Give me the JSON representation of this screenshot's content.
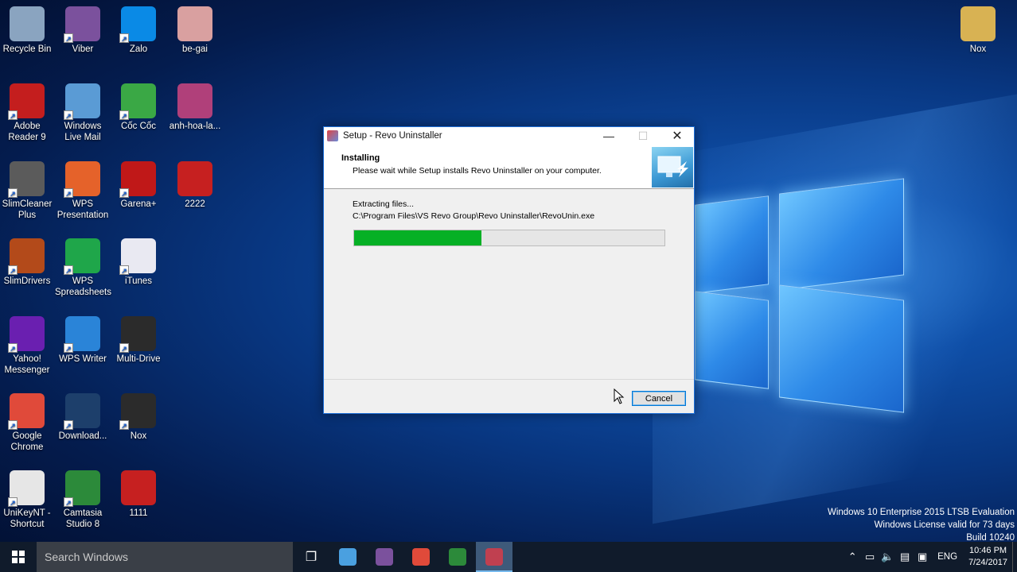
{
  "desktop": {
    "icons": [
      {
        "label": "Recycle Bin",
        "icon": "recycle-bin-icon",
        "color": "#8aa4c0"
      },
      {
        "label": "Viber",
        "icon": "viber-icon",
        "color": "#7b519d"
      },
      {
        "label": "Zalo",
        "icon": "zalo-icon",
        "color": "#0a8ae6"
      },
      {
        "label": "be-gai",
        "icon": "photo-icon",
        "color": "#d9a0a0"
      },
      {
        "label": "Adobe Reader 9",
        "icon": "adobe-reader-icon",
        "color": "#c41e1e"
      },
      {
        "label": "Windows Live Mail",
        "icon": "live-mail-icon",
        "color": "#5a9bd5"
      },
      {
        "label": "Cốc Cốc",
        "icon": "coccoc-icon",
        "color": "#3aa845"
      },
      {
        "label": "anh-hoa-la...",
        "icon": "photo-icon",
        "color": "#b0407a"
      },
      {
        "label": "SlimCleaner Plus",
        "icon": "slimcleaner-icon",
        "color": "#5b5b5b"
      },
      {
        "label": "WPS Presentation",
        "icon": "wps-presentation-icon",
        "color": "#e5622a"
      },
      {
        "label": "Garena+",
        "icon": "garena-icon",
        "color": "#c01818"
      },
      {
        "label": "2222",
        "icon": "video-icon",
        "color": "#c62020"
      },
      {
        "label": "SlimDrivers",
        "icon": "slimdrivers-icon",
        "color": "#b34a1a"
      },
      {
        "label": "WPS Spreadsheets",
        "icon": "wps-spreadsheets-icon",
        "color": "#1fa64a"
      },
      {
        "label": "iTunes",
        "icon": "itunes-icon",
        "color": "#e9e9f2"
      },
      {
        "label": "Yahoo! Messenger",
        "icon": "yahoo-messenger-icon",
        "color": "#6a1fb0"
      },
      {
        "label": "WPS Writer",
        "icon": "wps-writer-icon",
        "color": "#2a84d8"
      },
      {
        "label": "Multi-Drive",
        "icon": "nox-icon",
        "color": "#2b2b2b"
      },
      {
        "label": "Google Chrome",
        "icon": "chrome-icon",
        "color": "#e04a3a"
      },
      {
        "label": "Download...",
        "icon": "download-icon",
        "color": "#1d3f6b"
      },
      {
        "label": "Nox",
        "icon": "nox-icon",
        "color": "#2b2b2b"
      },
      {
        "label": "UniKeyNT - Shortcut",
        "icon": "unikey-icon",
        "color": "#e6e6e6"
      },
      {
        "label": "Camtasia Studio 8",
        "icon": "camtasia-icon",
        "color": "#2c8a3a"
      },
      {
        "label": "1111",
        "icon": "video-icon",
        "color": "#c62020"
      },
      {
        "label": "Nox",
        "icon": "folder-icon",
        "color": "#d8b253"
      }
    ]
  },
  "dialog": {
    "title": "Setup - Revo Uninstaller",
    "heading": "Installing",
    "subheading": "Please wait while Setup installs Revo Uninstaller on your computer.",
    "status": "Extracting files...",
    "file_path": "C:\\Program Files\\VS Revo Group\\Revo Uninstaller\\RevoUnin.exe",
    "progress": 0.41,
    "cancel_label": "Cancel",
    "minimize_glyph": "—",
    "maximize_glyph": "☐",
    "close_glyph": "✕",
    "accent": "#06b025"
  },
  "watermark": {
    "line1": "Windows 10 Enterprise 2015 LTSB Evaluation",
    "line2": "Windows License valid for 73 days",
    "line3": "Build 10240"
  },
  "taskbar": {
    "search_placeholder": "Search Windows",
    "apps": [
      {
        "icon": "task-view-icon",
        "glyph": "❐",
        "color": "#ffffff"
      },
      {
        "icon": "file-explorer-icon",
        "glyph": "",
        "color": "#4aa0e0"
      },
      {
        "icon": "viber-icon",
        "glyph": "",
        "color": "#7b519d"
      },
      {
        "icon": "chrome-icon",
        "glyph": "",
        "color": "#e04a3a"
      },
      {
        "icon": "camtasia-icon",
        "glyph": "",
        "color": "#2c8a3a"
      },
      {
        "icon": "revo-setup-icon",
        "glyph": "",
        "color": "#c04050"
      }
    ],
    "tray": {
      "chevron": "⌃",
      "battery": "▭",
      "volume": "🔈",
      "network": "▤",
      "notifications": "▣",
      "language": "ENG",
      "time": "10:46 PM",
      "date": "7/24/2017"
    }
  }
}
